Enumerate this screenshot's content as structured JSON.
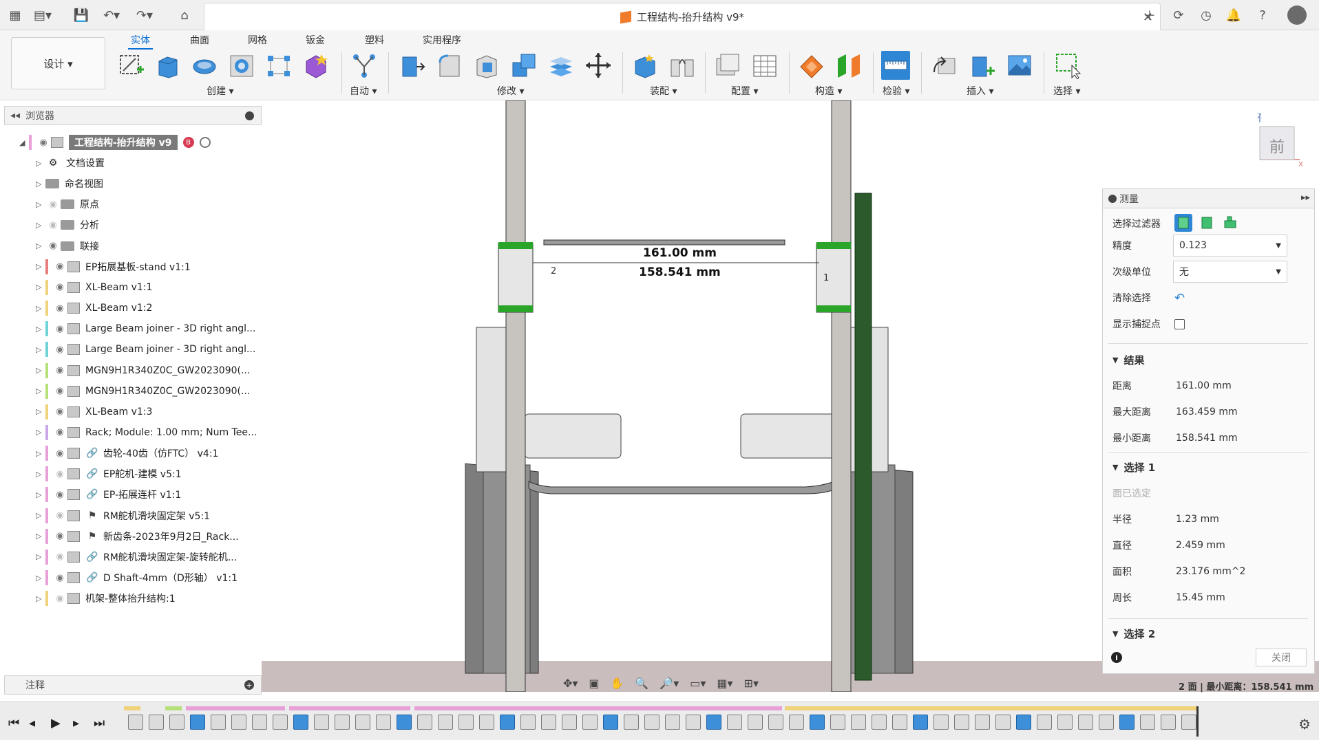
{
  "titlebar": {
    "doc_title": "工程结构-抬升结构 v9*",
    "icons": [
      "apps-grid-icon",
      "file-icon",
      "save-icon",
      "undo-icon",
      "redo-icon",
      "home-icon",
      "new-tab-icon",
      "refresh-icon",
      "history-icon",
      "bell-icon",
      "help-icon",
      "avatar"
    ]
  },
  "ribbon": {
    "workspace": "设计 ▾",
    "tabs": [
      "实体",
      "曲面",
      "网格",
      "钣金",
      "塑料",
      "实用程序"
    ],
    "active_tab": "实体",
    "groups": [
      "创建 ▾",
      "自动 ▾",
      "修改 ▾",
      "装配 ▾",
      "配置 ▾",
      "构造 ▾",
      "检验 ▾",
      "插入 ▾",
      "选择 ▾"
    ]
  },
  "browser": {
    "title": "浏览器",
    "root": "工程结构-抬升结构 v9",
    "items": [
      {
        "label": "文档设置",
        "type": "gear"
      },
      {
        "label": "命名视图",
        "type": "folder"
      },
      {
        "label": "原点",
        "type": "folder"
      },
      {
        "label": "分析",
        "type": "folder"
      },
      {
        "label": "联接",
        "type": "folder"
      },
      {
        "label": "EP拓展基板-stand v1:1",
        "type": "comp",
        "color": "#e87f7f"
      },
      {
        "label": "XL-Beam v1:1",
        "type": "comp",
        "color": "#f0d27a"
      },
      {
        "label": "XL-Beam v1:2",
        "type": "comp",
        "color": "#f0d27a"
      },
      {
        "label": "Large Beam joiner - 3D right angl...",
        "type": "comp",
        "color": "#6fd3d8"
      },
      {
        "label": "Large Beam joiner - 3D right angl...",
        "type": "comp",
        "color": "#6fd3d8"
      },
      {
        "label": "MGN9H1R340Z0C_GW2023090(...",
        "type": "comp",
        "color": "#b6e07a"
      },
      {
        "label": "MGN9H1R340Z0C_GW2023090(...",
        "type": "comp",
        "color": "#b6e07a"
      },
      {
        "label": "XL-Beam v1:3",
        "type": "comp",
        "color": "#f0d27a"
      },
      {
        "label": "Rack; Module: 1.00 mm; Num Tee...",
        "type": "comp",
        "color": "#c9a7e8"
      },
      {
        "label": "齿轮-40齿（仿FTC） v4:1",
        "type": "link",
        "color": "#e8a0d8"
      },
      {
        "label": "EP舵机-建模 v5:1",
        "type": "link",
        "color": "#e8a0d8"
      },
      {
        "label": "EP-拓展连杆 v1:1",
        "type": "link",
        "color": "#e8a0d8"
      },
      {
        "label": "RM舵机滑块固定架 v5:1",
        "type": "flag",
        "color": "#e8a0d8"
      },
      {
        "label": "新齿条-2023年9月2日_Rack...",
        "type": "flag",
        "color": "#e8a0d8"
      },
      {
        "label": "RM舵机滑块固定架-旋转舵机...",
        "type": "link",
        "color": "#e8a0d8"
      },
      {
        "label": "D Shaft-4mm（D形轴） v1:1",
        "type": "link",
        "color": "#e8a0d8"
      },
      {
        "label": "机架-整体抬升结构:1",
        "type": "comp",
        "color": "#f0d27a"
      }
    ]
  },
  "notes": {
    "title": "注释"
  },
  "viewport": {
    "dim_top": "161.00 mm",
    "dim_bottom": "158.541 mm",
    "viewcube_label": "前",
    "status": "2 面 | 最小距离：158.541 mm"
  },
  "measure": {
    "title": "测量",
    "filter_label": "选择过滤器",
    "precision_label": "精度",
    "precision_value": "0.123",
    "secondary_unit_label": "次级单位",
    "secondary_unit_value": "无",
    "clear_label": "清除选择",
    "show_snap_label": "显示捕捉点",
    "results_title": "结果",
    "results": [
      {
        "label": "距离",
        "value": "161.00 mm"
      },
      {
        "label": "最大距离",
        "value": "163.459 mm"
      },
      {
        "label": "最小距离",
        "value": "158.541 mm"
      }
    ],
    "sel1_title": "选择 1",
    "sel1_note": "面已选定",
    "sel1": [
      {
        "label": "半径",
        "value": "1.23 mm"
      },
      {
        "label": "直径",
        "value": "2.459 mm"
      },
      {
        "label": "面积",
        "value": "23.176 mm^2"
      },
      {
        "label": "周长",
        "value": "15.45 mm"
      }
    ],
    "sel2_title": "选择 2",
    "close_label": "关闭"
  }
}
